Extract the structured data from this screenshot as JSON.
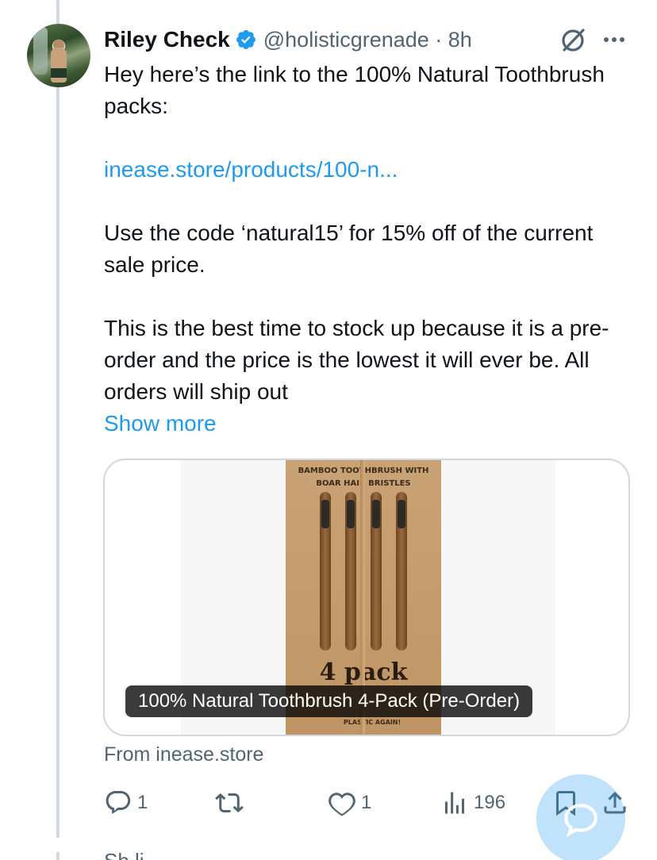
{
  "post": {
    "author_name": "Riley Check",
    "handle_time": "@holisticgrenade · 8h",
    "paragraph1": "Hey here’s the link to the 100% Natural Toothbrush packs:",
    "link": "inease.store/products/100-n...",
    "paragraph2": "Use the code ‘natural15’ for 15% off of the current sale price.",
    "paragraph3": "This is the best time to stock up because it is a pre-order and the price is the lowest it will ever be. All orders will ship out",
    "show_more": "Show more"
  },
  "card": {
    "box_title_line1": "BAMBOO TOOTHBRUSH WITH",
    "box_title_line2": "BOAR HAIR BRISTLES",
    "box_pack": "4 pack",
    "box_bottom": "PLASTIC AGAIN!",
    "caption": "100% Natural Toothbrush 4-Pack (Pre-Order)",
    "source": "From inease.store"
  },
  "actions": {
    "replies": "1",
    "likes": "1",
    "views": "196"
  },
  "cut_off_text": "Sh      li"
}
